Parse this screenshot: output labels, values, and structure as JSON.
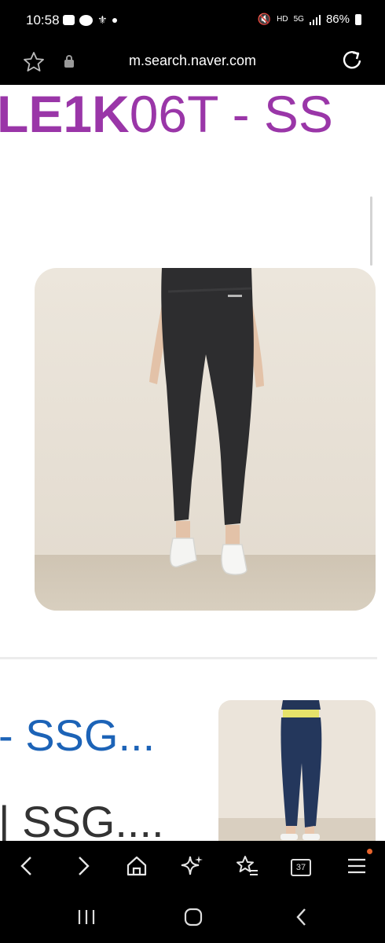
{
  "status_bar": {
    "time": "10:58",
    "battery": "86%",
    "network": "5G",
    "hd_label": "HD"
  },
  "browser": {
    "url": "m.search.naver.com",
    "tab_count": "37"
  },
  "page": {
    "headline_bold": "LE1K",
    "headline_rest": "06T - SS",
    "result_title": "- SSG...",
    "result_sub": "| SSG....",
    "colors": {
      "headline": "#9a36a8",
      "result_title": "#1c63b7",
      "menu_badge": "#e8642c"
    }
  },
  "icons": {
    "bookmark": "star-icon",
    "secure": "lock-icon",
    "reload": "reload-icon",
    "back": "chevron-left-icon",
    "forward": "chevron-right-icon",
    "home": "home-icon",
    "ai": "sparkle-icon",
    "bookmarks": "star-list-icon",
    "tabs": "tabs-icon",
    "menu": "hamburger-icon",
    "recents": "recents-icon",
    "system_home": "circle-home-icon",
    "system_back": "system-back-icon"
  }
}
